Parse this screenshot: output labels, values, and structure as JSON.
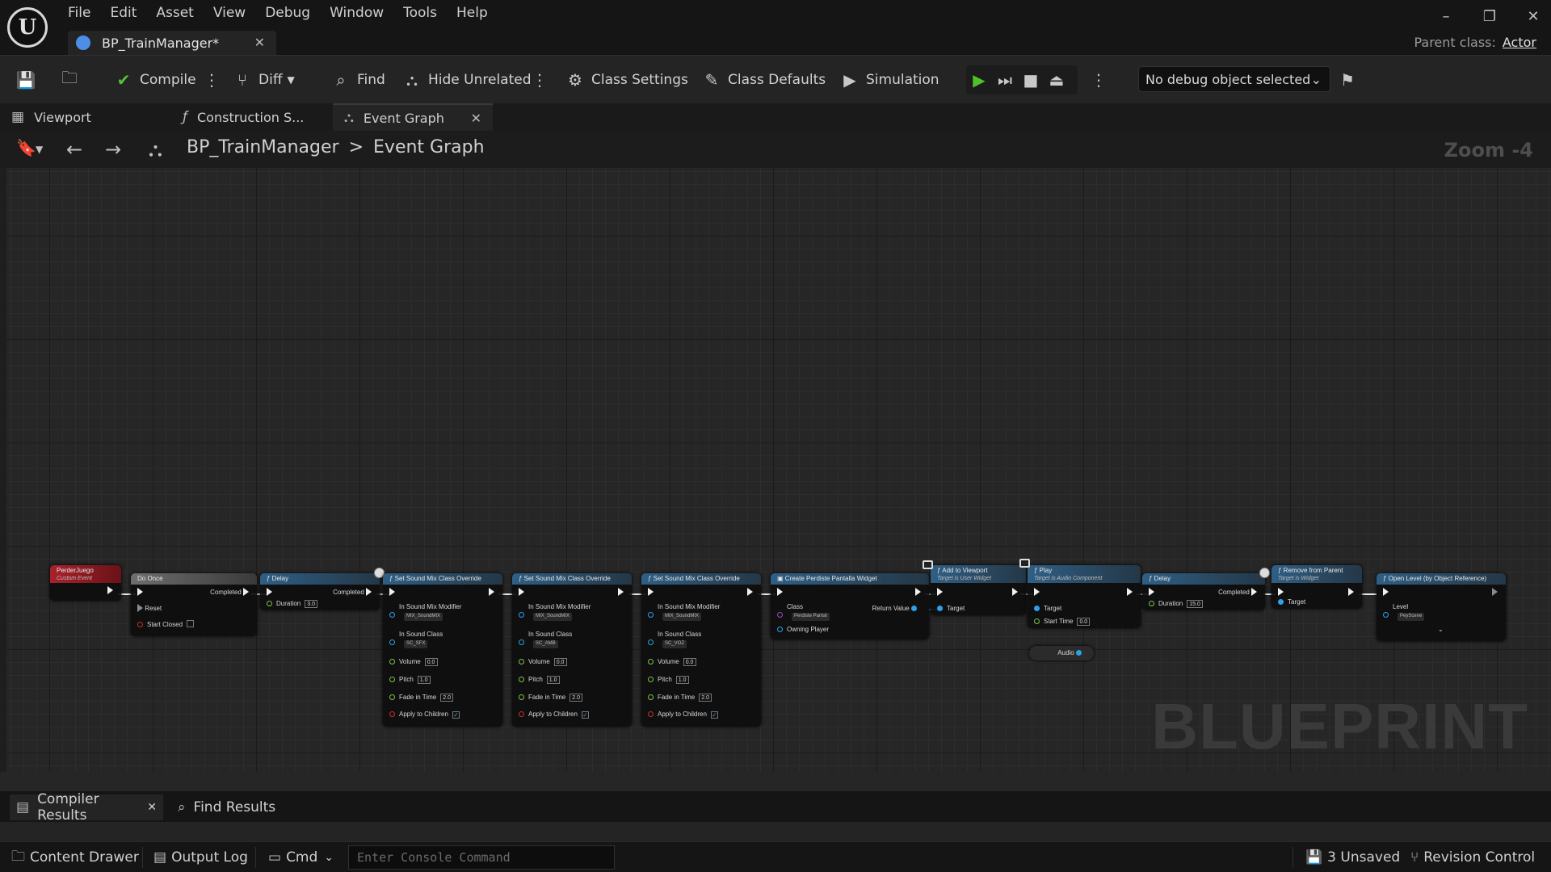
{
  "app": {
    "menu": [
      "File",
      "Edit",
      "Asset",
      "View",
      "Debug",
      "Window",
      "Tools",
      "Help"
    ],
    "doc_tab": "BP_TrainManager*",
    "parent_class_label": "Parent class:",
    "parent_class_value": "Actor"
  },
  "toolbar": {
    "compile": "Compile",
    "diff": "Diff",
    "find": "Find",
    "hide_unrelated": "Hide Unrelated",
    "class_settings": "Class Settings",
    "class_defaults": "Class Defaults",
    "simulation": "Simulation",
    "debug_object": "No debug object selected"
  },
  "graph_tabs": [
    "Viewport",
    "Construction S...",
    "Event Graph"
  ],
  "breadcrumb": {
    "root": "BP_TrainManager",
    "separator": ">",
    "current": "Event Graph",
    "zoom": "Zoom -4"
  },
  "watermark": "BLUEPRINT",
  "nodes": {
    "perder": {
      "title": "PerderJuego",
      "subtitle": "Custom Event"
    },
    "doonce": {
      "title": "Do Once",
      "completed": "Completed",
      "reset": "Reset",
      "start_closed": "Start Closed"
    },
    "delay1": {
      "title": "Delay",
      "completed": "Completed",
      "duration_label": "Duration",
      "duration": "3.0"
    },
    "mix1": {
      "title": "Set Sound Mix Class Override",
      "modifier_label": "In Sound Mix Modifier",
      "modifier": "MIX_SoundMIX",
      "class_label": "In Sound Class",
      "class": "SC_SFX",
      "volume_label": "Volume",
      "volume": "0.0",
      "pitch_label": "Pitch",
      "pitch": "1.0",
      "fade_label": "Fade in Time",
      "fade": "2.0",
      "apply_label": "Apply to Children"
    },
    "mix2": {
      "title": "Set Sound Mix Class Override",
      "modifier_label": "In Sound Mix Modifier",
      "modifier": "MIX_SoundMIX",
      "class_label": "In Sound Class",
      "class": "SC_AMB",
      "volume_label": "Volume",
      "volume": "0.0",
      "pitch_label": "Pitch",
      "pitch": "1.0",
      "fade_label": "Fade in Time",
      "fade": "2.0",
      "apply_label": "Apply to Children"
    },
    "mix3": {
      "title": "Set Sound Mix Class Override",
      "modifier_label": "In Sound Mix Modifier",
      "modifier": "MIX_SoundMIX",
      "class_label": "In Sound Class",
      "class": "SC_VOZ",
      "volume_label": "Volume",
      "volume": "0.0",
      "pitch_label": "Pitch",
      "pitch": "1.0",
      "fade_label": "Fade in Time",
      "fade": "2.0",
      "apply_label": "Apply to Children"
    },
    "create": {
      "title": "Create Perdiste Pantalla Widget",
      "class_label": "Class",
      "class": "Perdiste Pantal",
      "return_label": "Return Value",
      "owning_label": "Owning Player"
    },
    "addvp": {
      "title": "Add to Viewport",
      "subtitle": "Target is User Widget",
      "target_label": "Target"
    },
    "play": {
      "title": "Play",
      "subtitle": "Target is Audio Component",
      "target_label": "Target",
      "start_label": "Start Time",
      "start": "0.0"
    },
    "audio": {
      "label": "Audio"
    },
    "delay2": {
      "title": "Delay",
      "completed": "Completed",
      "duration_label": "Duration",
      "duration": "15.0"
    },
    "remove": {
      "title": "Remove from Parent",
      "subtitle": "Target is Widget",
      "target_label": "Target"
    },
    "openlevel": {
      "title": "Open Level (by Object Reference)",
      "level_label": "Level",
      "level": "PeyScene"
    }
  },
  "bottom_tabs": {
    "compiler": "Compiler Results",
    "find": "Find Results"
  },
  "statusbar": {
    "content_drawer": "Content Drawer",
    "output_log": "Output Log",
    "cmd": "Cmd",
    "console_placeholder": "Enter Console Command",
    "unsaved": "3 Unsaved",
    "revision": "Revision Control"
  },
  "colors": {
    "function_node": "#2f5f86",
    "event_node": "#a8222a",
    "macro_node": "#6e6e6e",
    "play_accent": "#4fc12b"
  }
}
